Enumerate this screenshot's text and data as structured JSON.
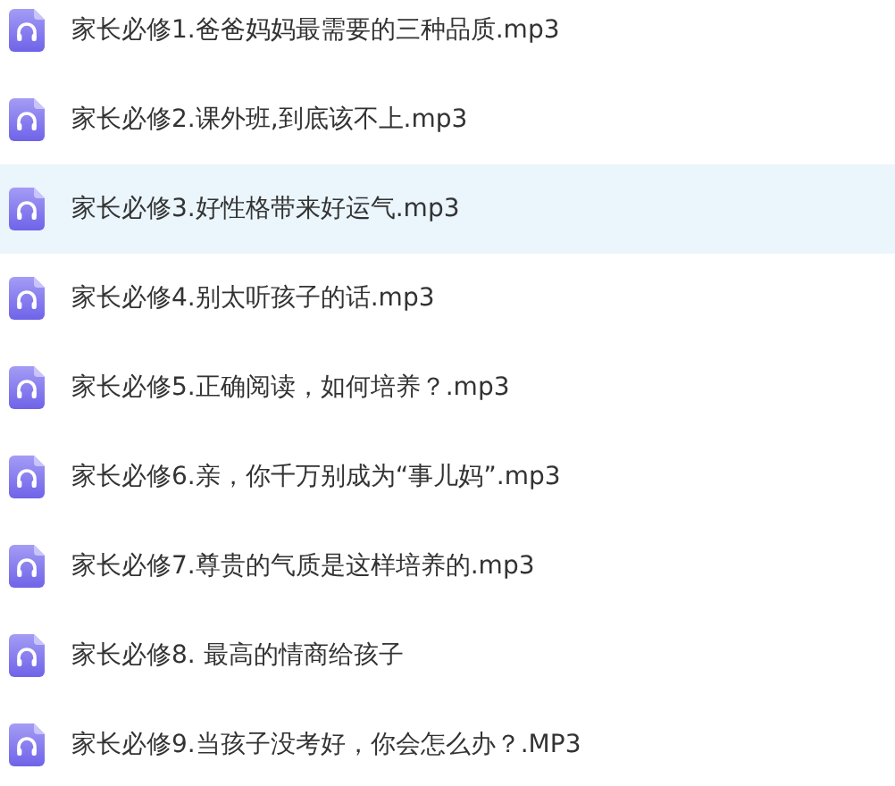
{
  "files": [
    {
      "name": "家长必修1.爸爸妈妈最需要的三种品质.mp3",
      "selected": false
    },
    {
      "name": "家长必修2.课外班,到底该不上.mp3",
      "selected": false
    },
    {
      "name": "家长必修3.好性格带来好运气.mp3",
      "selected": true
    },
    {
      "name": "家长必修4.别太听孩子的话.mp3",
      "selected": false
    },
    {
      "name": "家长必修5.正确阅读，如何培养？.mp3",
      "selected": false
    },
    {
      "name": "家长必修6.亲，你千万别成为“事儿妈”.mp3",
      "selected": false
    },
    {
      "name": "家长必修7.尊贵的气质是这样培养的.mp3",
      "selected": false
    },
    {
      "name": "家长必修8. 最高的情商给孩子",
      "selected": false
    },
    {
      "name": "家长必修9.当孩子没考好，你会怎么办？.MP3",
      "selected": false
    }
  ]
}
